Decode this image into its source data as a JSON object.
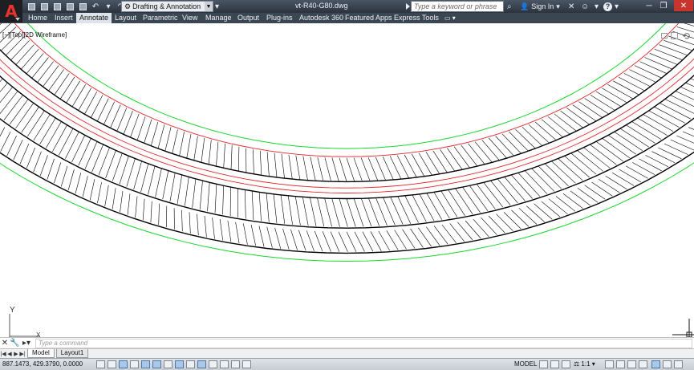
{
  "title_bar": {
    "document_title": "vt-R40-G80.dwg",
    "workspace": "Drafting & Annotation",
    "search_placeholder": "Type a keyword or phrase",
    "sign_in": "Sign In",
    "help_icon": "question-icon"
  },
  "ribbon": {
    "tabs": [
      {
        "label": "Home",
        "active": false
      },
      {
        "label": "Insert",
        "active": false
      },
      {
        "label": "Annotate",
        "active": true
      },
      {
        "label": "Layout",
        "active": false
      },
      {
        "label": "Parametric",
        "active": false
      },
      {
        "label": "View",
        "active": false
      },
      {
        "label": "Manage",
        "active": false
      },
      {
        "label": "Output",
        "active": false
      },
      {
        "label": "Plug-ins",
        "active": false
      },
      {
        "label": "Autodesk 360",
        "active": false
      },
      {
        "label": "Featured Apps",
        "active": false
      },
      {
        "label": "Express Tools",
        "active": false
      }
    ]
  },
  "viewport": {
    "label": "[−][Top][2D Wireframe]"
  },
  "ucs": {
    "y_label": "Y",
    "x_label": "X"
  },
  "command_line": {
    "placeholder": "Type a command"
  },
  "layout_tabs": {
    "tabs": [
      {
        "label": "Model",
        "active": true
      },
      {
        "label": "Layout1",
        "active": false
      }
    ]
  },
  "status_bar": {
    "coordinates": "887.1473, 429.3790, 0.0000",
    "model_label": "MODEL",
    "annotation_scale": "1:1"
  },
  "colors": {
    "titlebar": "#2b333d",
    "ribbon_bg": "#3b4653",
    "active_tab": "#dde3ea",
    "curve_green": "#17d62e",
    "curve_red": "#e0262b",
    "hatch": "#000000"
  }
}
